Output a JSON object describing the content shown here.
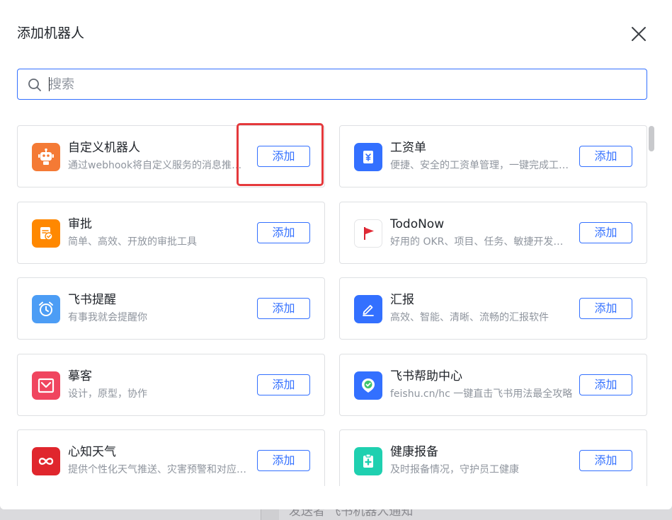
{
  "dialog": {
    "title": "添加机器人",
    "search_placeholder": "搜索",
    "add_label": "添加"
  },
  "background": {
    "partial_text": "发送者 飞书机器人通知"
  },
  "bots": [
    {
      "name": "自定义机器人",
      "desc": "通过webhook将自定义服务的消息推送至飞书",
      "icon": "robot-icon",
      "color": "#f47a35"
    },
    {
      "name": "工资单",
      "desc": "便捷、安全的工资单管理，一键完成工资发放",
      "icon": "payslip-icon",
      "color": "#3370ff"
    },
    {
      "name": "审批",
      "desc": "简单、高效、开放的审批工具",
      "icon": "approval-icon",
      "color": "#ff8800"
    },
    {
      "name": "TodoNow",
      "desc": "好用的 OKR、项目、任务、敏捷开发管理工具",
      "icon": "red-flag-icon",
      "color": "#ffffff"
    },
    {
      "name": "飞书提醒",
      "desc": "有事我就会提醒你",
      "icon": "alarm-clock-icon",
      "color": "#4c9df5"
    },
    {
      "name": "汇报",
      "desc": "高效、智能、清晰、流畅的汇报软件",
      "icon": "pen-icon",
      "color": "#3370ff"
    },
    {
      "name": "摹客",
      "desc": "设计，原型，协作",
      "icon": "mockplus-icon",
      "color": "#f0455f"
    },
    {
      "name": "飞书帮助中心",
      "desc": "feishu.cn/hc 一键直击飞书用法最全攻略",
      "icon": "help-center-icon",
      "color": "#3370ff"
    },
    {
      "name": "心知天气",
      "desc": "提供个性化天气推送、灾害预警和对应建议",
      "icon": "infinity-icon",
      "color": "#e0262d"
    },
    {
      "name": "健康报备",
      "desc": "及时报备情况，守护员工健康",
      "icon": "health-report-icon",
      "color": "#1fd0b0"
    }
  ]
}
